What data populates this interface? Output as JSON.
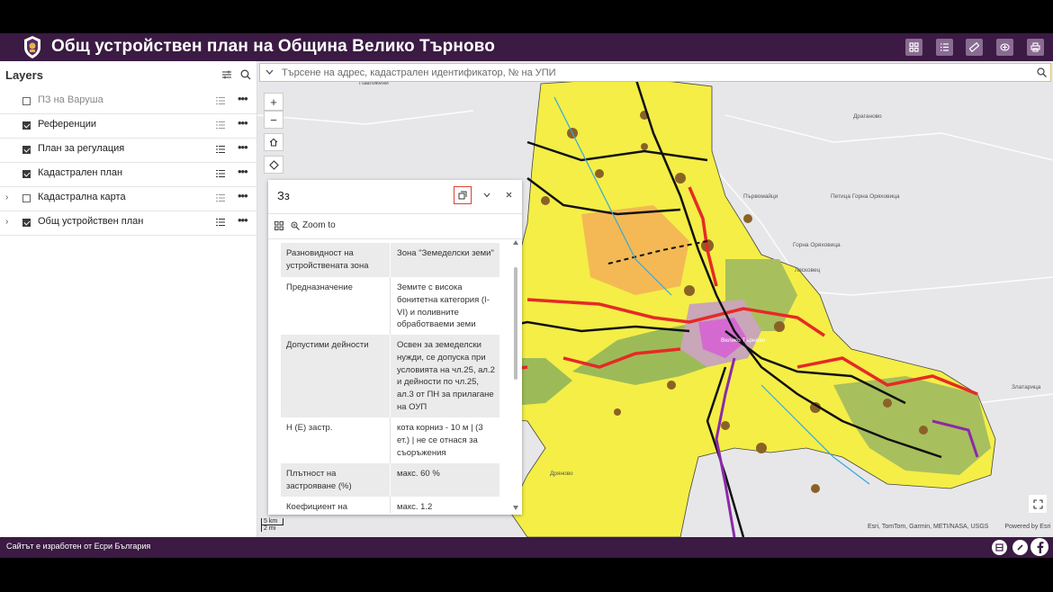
{
  "header": {
    "title": "Общ устройствен план на Община Велико Търново",
    "bg_color": "#3b1a43",
    "actions": [
      "grid-icon",
      "list-icon",
      "measure-icon",
      "layers-icon",
      "print-icon"
    ]
  },
  "layers_panel": {
    "title": "Layers",
    "items": [
      {
        "label": "ПЗ на Варуша",
        "checked": false,
        "expandable": false
      },
      {
        "label": "Референции",
        "checked": true,
        "expandable": false
      },
      {
        "label": "План за регулация",
        "checked": true,
        "expandable": false
      },
      {
        "label": "Кадастрален план",
        "checked": true,
        "expandable": false
      },
      {
        "label": "Кадастрална карта",
        "checked": false,
        "expandable": true
      },
      {
        "label": "Общ устройствен план",
        "checked": true,
        "expandable": true
      }
    ]
  },
  "search": {
    "placeholder": "Търсене на адрес, кадастрален идентификатор, № на УПИ"
  },
  "popup": {
    "title": "Зз",
    "zoom_to": "Zoom to",
    "rows": [
      {
        "key": "Разновидност на устройствената зона",
        "value": "Зона \"Земеделски земи\""
      },
      {
        "key": "Предназначение",
        "value": "Земите с висока бонитетна категория (I-VI) и поливните обработваеми земи"
      },
      {
        "key": "Допустими дейности",
        "value": "Освен за земеделски нужди, се допуска при условията на чл.25, ал.2 и дейности по чл.25, ал.3 от ПН за прилагане на ОУП"
      },
      {
        "key": "Н (Е) застр.",
        "value": "кота корниз - 10 м | (3 ет.) | не се отнася за съоръжения"
      },
      {
        "key": "Плътност на застрояване (%)",
        "value": "макс. 60 %"
      },
      {
        "key": "Коефициент на",
        "value": "макс. 1.2"
      }
    ]
  },
  "map": {
    "places": [
      "Павликени",
      "Драганово",
      "Първомайци",
      "Петица Горна Оряховица",
      "Горна Оряховица",
      "Лясковец",
      "Велико Търново",
      "Златарица",
      "Дряново"
    ],
    "scale": {
      "km": "5 km",
      "mi": "2 mi"
    },
    "attribution": "Esri, TomTom, Garmin, METI/NASA, USGS",
    "powered": "Powered by Esri"
  },
  "footer": {
    "text": "Сайтът е изработен от Есри България",
    "icons": [
      "esri-icon",
      "link-icon",
      "facebook-icon"
    ]
  }
}
